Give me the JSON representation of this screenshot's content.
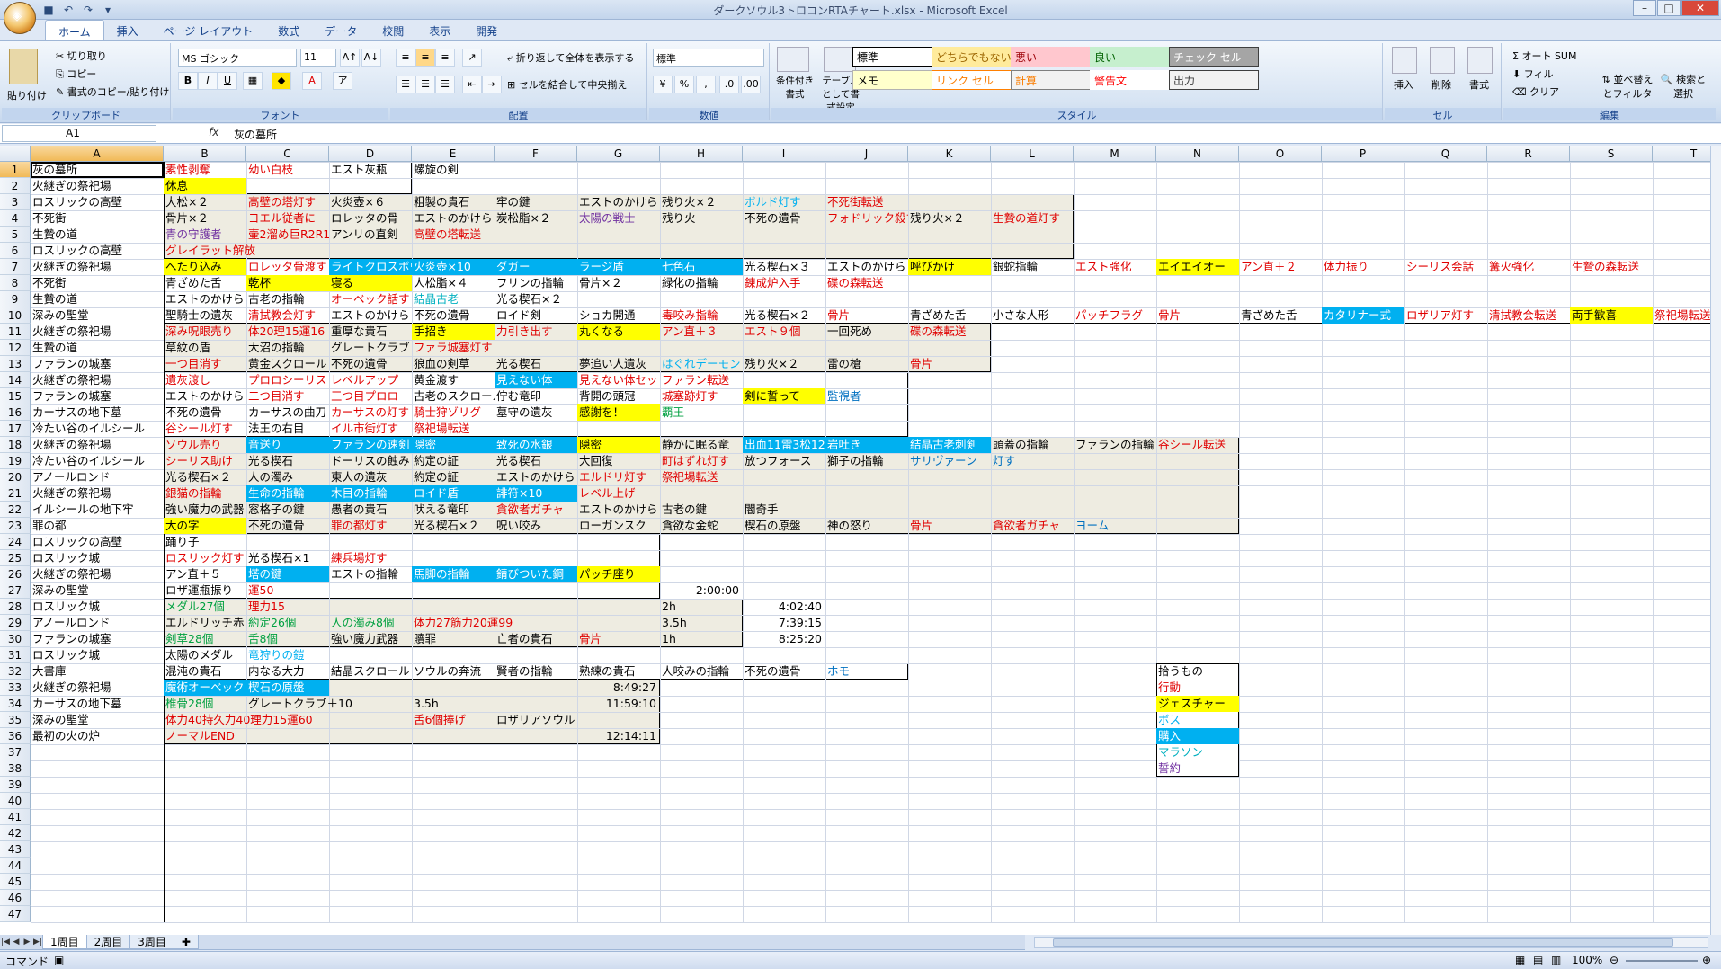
{
  "window": {
    "title": "ダークソウル3トロコンRTAチャート.xlsx - Microsoft Excel"
  },
  "tabs": [
    "ホーム",
    "挿入",
    "ページ レイアウト",
    "数式",
    "データ",
    "校閲",
    "表示",
    "開発"
  ],
  "ribbon": {
    "clipboard": {
      "label": "クリップボード",
      "paste": "貼り付け",
      "cut": "切り取り",
      "copy": "コピー",
      "format_painter": "書式のコピー/貼り付け"
    },
    "font": {
      "label": "フォント",
      "name": "MS ゴシック",
      "size": "11"
    },
    "alignment": {
      "label": "配置",
      "wrap": "折り返して全体を表示する",
      "merge": "セルを結合して中央揃え"
    },
    "number": {
      "label": "数値",
      "format": "標準"
    },
    "styles": {
      "label": "スタイル",
      "conditional": "条件付き書式",
      "table": "テーブルとして書式設定",
      "cells": [
        {
          "text": "標準",
          "bg": "#ffffff",
          "fg": "#000000",
          "border": "#000000"
        },
        {
          "text": "どちらでもない",
          "bg": "#ffeb9c",
          "fg": "#9c6500",
          "border": "#ffeb9c"
        },
        {
          "text": "悪い",
          "bg": "#ffc7ce",
          "fg": "#9c0006",
          "border": "#ffc7ce"
        },
        {
          "text": "良い",
          "bg": "#c6efce",
          "fg": "#006100",
          "border": "#c6efce"
        },
        {
          "text": "チェック セル",
          "bg": "#a5a5a5",
          "fg": "#ffffff",
          "border": "#3f3f3f"
        },
        {
          "text": "メモ",
          "bg": "#ffffcc",
          "fg": "#000000",
          "border": "#b2b2b2"
        },
        {
          "text": "リンク セル",
          "bg": "#ffffff",
          "fg": "#fa7d00",
          "border": "#ff8001"
        },
        {
          "text": "計算",
          "bg": "#f2f2f2",
          "fg": "#fa7d00",
          "border": "#7f7f7f"
        },
        {
          "text": "警告文",
          "bg": "#ffffff",
          "fg": "#ff0000",
          "border": "#ffffff"
        },
        {
          "text": "出力",
          "bg": "#f2f2f2",
          "fg": "#3f3f3f",
          "border": "#3f3f3f"
        }
      ]
    },
    "cellsgrp": {
      "label": "セル",
      "insert": "挿入",
      "delete": "削除",
      "format": "書式"
    },
    "editing": {
      "label": "編集",
      "autosum": "オート SUM",
      "fill": "フィル",
      "clear": "クリア",
      "sort": "並べ替えとフィルタ",
      "find": "検索と選択"
    }
  },
  "formula": {
    "namebox": "A1",
    "fx": "fx",
    "content": "灰の墓所"
  },
  "columns": [
    "A",
    "B",
    "C",
    "D",
    "E",
    "F",
    "G",
    "H",
    "I",
    "J",
    "K",
    "L",
    "M",
    "N",
    "O",
    "P",
    "Q",
    "R",
    "S",
    "T"
  ],
  "rows": [
    [
      "灰の墓所",
      "素性剥奪",
      "幼い白枝",
      "エスト灰瓶",
      "螺旋の剣"
    ],
    [
      "火継ぎの祭祀場",
      "休息"
    ],
    [
      "ロスリックの高壁",
      "大松×２",
      "高壁の塔灯す",
      "火炎壺×６",
      "粗製の貴石",
      "牢の鍵",
      "エストのかけら",
      "残り火×２",
      "ボルド灯す",
      "不死街転送"
    ],
    [
      "不死街",
      "骨片×２",
      "ヨエル従者に",
      "ロレッタの骨",
      "エストのかけら",
      "炭松脂×２",
      "太陽の戦士",
      "残り火",
      "不死の遺骨",
      "フォドリック殺す",
      "残り火×２",
      "生贄の道灯す"
    ],
    [
      "生贄の道",
      "青の守護者",
      "壷2溜め巨R2R1",
      "アンリの直剣",
      "高壁の塔転送"
    ],
    [
      "ロスリックの高壁",
      "グレイラット解放"
    ],
    [
      "火継ぎの祭祀場",
      "へたり込み",
      "ロレッタ骨渡す",
      "ライトクロスボウ",
      "火炎壺×10",
      "ダガー",
      "ラージ盾",
      "七色石",
      "光る楔石×３",
      "エストのかけら",
      "呼びかけ",
      "銀蛇指輪",
      "エスト強化",
      "エイエイオー",
      "アン直＋２",
      "体力振り",
      "シーリス会話",
      "篝火強化",
      "生贄の森転送"
    ],
    [
      "不死街",
      "青ざめた舌",
      "乾杯",
      "寝る",
      "人松脂×４",
      "フリンの指輪",
      "骨片×２",
      "緑化の指輪",
      "錬成炉入手",
      "碟の森転送"
    ],
    [
      "生贄の道",
      "エストのかけら",
      "古老の指輪",
      "オーベック話す",
      "結晶古老",
      "光る楔石×２"
    ],
    [
      "深みの聖堂",
      "聖騎士の遺灰",
      "清拭教会灯す",
      "エストのかけら",
      "不死の遺骨",
      "ロイド剣",
      "ショカ開通",
      "毒咬み指輪",
      "光る楔石×２",
      "骨片",
      "青ざめた舌",
      "小さな人形",
      "パッチフラグ",
      "骨片",
      "青ざめた舌",
      "カタリナー式",
      "ロザリア灯す",
      "清拭教会転送",
      "両手歓喜",
      "祭祀場転送"
    ],
    [
      "火継ぎの祭祀場",
      "深み呪眼売り",
      "体20理15運16",
      "重厚な貴石",
      "手招き",
      "力引き出す",
      "丸くなる",
      "アン直＋３",
      "エスト９個",
      "一回死め",
      "碟の森転送"
    ],
    [
      "生贄の道",
      "草紋の盾",
      "大沼の指輪",
      "グレートクラブ",
      "ファラ城塞灯す"
    ],
    [
      "ファランの城塞",
      "一つ目消す",
      "黄金スクロール",
      "不死の遺骨",
      "狼血の剣草",
      "光る楔石",
      "夢追い人遺灰",
      "はぐれデーモン",
      "残り火×２",
      "雷の槍",
      "骨片"
    ],
    [
      "火継ぎの祭祀場",
      "遺灰渡し",
      "プロロシーリス",
      "レベルアップ",
      "黄金渡す",
      "見えない体",
      "見えない体セット",
      "ファラン転送"
    ],
    [
      "ファランの城塞",
      "エストのかけら",
      "二つ目消す",
      "三つ目プロロ",
      "古老のスクロール",
      "佇む竜印",
      "背開の頭冠",
      "城塞跡灯す",
      "剣に誓って",
      "監視者"
    ],
    [
      "カーサスの地下墓",
      "不死の遺骨",
      "カーサスの曲刀",
      "カーサスの灯す",
      "騎士狩ゾリグ",
      "墓守の遺灰",
      "感謝を！",
      "覇王"
    ],
    [
      "冷たい谷のイルシール",
      "谷シール灯す",
      "法王の右目",
      "イル市街灯す",
      "祭祀場転送"
    ],
    [
      "火継ぎの祭祀場",
      "ソウル売り",
      "音送り",
      "ファランの速剣",
      "隠密",
      "致死の水銀",
      "隠密",
      "静かに眠る竜",
      "出血11雷3松12",
      "岩吐き",
      "結晶古老刺剣",
      "頭蓋の指輪",
      "ファランの指輪",
      "谷シール転送"
    ],
    [
      "冷たい谷のイルシール",
      "シーリス助け",
      "光る楔石",
      "ドーリスの蝕み",
      "約定の証",
      "光る楔石",
      "大回復",
      "町はずれ灯す",
      "放つフォース",
      "獅子の指輪",
      "サリヴァーン",
      "灯す"
    ],
    [
      "アノールロンド",
      "光る楔石×２",
      "人の濁み",
      "東人の遺灰",
      "約定の証",
      "エストのかけら",
      "エルドリ灯す",
      "祭祀場転送"
    ],
    [
      "火継ぎの祭祀場",
      "銀猫の指輪",
      "生命の指輪",
      "木目の指輪",
      "ロイド盾",
      "誹符×10",
      "レベル上げ"
    ],
    [
      "イルシールの地下牢",
      "強い魔力の武器",
      "窓格子の鍵",
      "愚者の貴石",
      "吠える竜印",
      "貪欲者ガチャ",
      "エストのかけら",
      "古老の鍵",
      "闇奇手"
    ],
    [
      "罪の都",
      "大の字",
      "不死の遺骨",
      "罪の都灯す",
      "光る楔石×２",
      "呪い咬み",
      "ローガンスク",
      "貪欲な金蛇",
      "楔石の原盤",
      "神の怒り",
      "骨片",
      "貪欲者ガチャ",
      "ヨーム"
    ],
    [
      "ロスリックの高壁",
      "踊り子"
    ],
    [
      "ロスリック城",
      "ロスリック灯す",
      "光る楔石×1",
      "練兵場灯す"
    ],
    [
      "火継ぎの祭祀場",
      "アン直＋５",
      "塔の鍵",
      "エストの指輪",
      "馬脚の指輪",
      "錆びついた鋼",
      "パッチ座り"
    ],
    [
      "深みの聖堂",
      "ロザ運瓶振り",
      "運50",
      "",
      "",
      "",
      "",
      "2:00:00"
    ],
    [
      "ロスリック城",
      "メダル27個",
      "理力15",
      "",
      "",
      "",
      "",
      "2h",
      "4:02:40"
    ],
    [
      "アノールロンド",
      "エルドリッチ赤",
      "約定26個",
      "人の濁み8個",
      "体力27筋力20運99",
      "",
      "",
      "3.5h",
      "7:39:15"
    ],
    [
      "ファランの城塞",
      "剣草28個",
      "舌8個",
      "強い魔力武器",
      "贖罪",
      "亡者の貴石",
      "骨片",
      "1h",
      "8:25:20"
    ],
    [
      "ロスリック城",
      "太陽のメダル",
      "竜狩りの鎧"
    ],
    [
      "大書庫",
      "混沌の貴石",
      "内なる大力",
      "結晶スクロール",
      "ソウルの奔流",
      "賢者の指輪",
      "熟練の貴石",
      "人咬みの指輪",
      "不死の遺骨",
      "ホモ"
    ],
    [
      "火継ぎの祭祀場",
      "魔術オーベック",
      "楔石の原盤",
      "",
      "",
      "",
      "8:49:27"
    ],
    [
      "カーサスの地下墓",
      "椎骨28個",
      "グレートクラブ＋10",
      "",
      "3.5h",
      "",
      "11:59:10"
    ],
    [
      "深みの聖堂",
      "体力40持久力40理力15運60",
      "",
      "",
      "舌6個捧げ",
      "ロザリアソウル"
    ],
    [
      "最初の火の炉",
      "ノーマルEND",
      "",
      "",
      "",
      "",
      "12:14:11"
    ]
  ],
  "legend": [
    "拾うもの",
    "行動",
    "ジェスチャー",
    "ボス",
    "購入",
    "マラソン",
    "誓約"
  ],
  "sheets": [
    "1周目",
    "2周目",
    "3周目"
  ],
  "status": {
    "mode": "コマンド",
    "zoom": "100%"
  }
}
